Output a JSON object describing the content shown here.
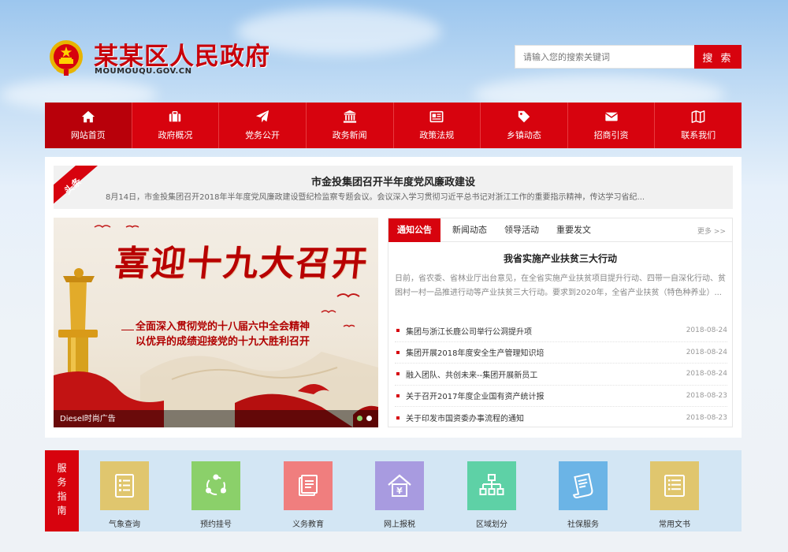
{
  "colors": {
    "brand_red": "#d7030e",
    "nav_active": "#b8000a",
    "service_bg": "#d3e6f4"
  },
  "header": {
    "emblem_icon": "national-emblem",
    "title": "某某区人民政府",
    "domain": "MOUMOUQU.GOV.CN",
    "search_placeholder": "请输入您的搜索关键词",
    "search_button": "搜 索"
  },
  "nav": {
    "items": [
      {
        "label": "网站首页",
        "icon": "home-icon",
        "active": true
      },
      {
        "label": "政府概况",
        "icon": "briefcase-icon"
      },
      {
        "label": "党务公开",
        "icon": "paper-plane-icon"
      },
      {
        "label": "政务新闻",
        "icon": "government-building-icon"
      },
      {
        "label": "政策法规",
        "icon": "newspaper-icon"
      },
      {
        "label": "乡镇动态",
        "icon": "tag-icon"
      },
      {
        "label": "招商引资",
        "icon": "envelope-icon"
      },
      {
        "label": "联系我们",
        "icon": "map-icon"
      }
    ]
  },
  "headline": {
    "tag": "头条",
    "title": "市金投集团召开半年度党风廉政建设",
    "summary": "8月14日，市金投集团召开2018年半年度党风廉政建设暨纪检监察专题会议。会议深入学习贯彻习近平总书记对浙江工作的重要指示精神，传达学习省纪..."
  },
  "banner": {
    "main_text": "喜迎十九大召开",
    "sub_line1": "全面深入贯彻党的十八届六中全会精神",
    "sub_line2": "以优异的成绩迎接党的十九大胜利召开",
    "caption": "Diesel时尚广告"
  },
  "news": {
    "tabs": [
      "通知公告",
      "新闻动态",
      "领导活动",
      "重要发文"
    ],
    "active_tab": 0,
    "more": "更多 >>",
    "feature_title": "我省实施产业扶贫三大行动",
    "feature_summary": "日前，省农委、省林业厅出台意见，在全省实施产业扶贫项目提升行动、四带一自深化行动、贫困村一村一品推进行动等产业扶贫三大行动。要求到2020年，全省产业扶贫（特色种养业）...",
    "items": [
      {
        "text": "集团与浙江长鹿公司举行公洞提升项",
        "date": "2018-08-24"
      },
      {
        "text": "集团开展2018年度安全生产管理知识培",
        "date": "2018-08-24"
      },
      {
        "text": "融入团队、共创未来--集团开展新员工",
        "date": "2018-08-24"
      },
      {
        "text": "关于召开2017年度企业国有资产统计报",
        "date": "2018-08-23"
      },
      {
        "text": "关于印发市国资委办事流程的通知",
        "date": "2018-08-23"
      }
    ]
  },
  "service": {
    "label": "服务指南",
    "items": [
      {
        "label": "气象查询",
        "icon": "document-list-icon",
        "color": "#e0c66e"
      },
      {
        "label": "预约挂号",
        "icon": "share-nodes-icon",
        "color": "#8bd06a"
      },
      {
        "label": "义务教育",
        "icon": "book-pages-icon",
        "color": "#f07e7e"
      },
      {
        "label": "网上报税",
        "icon": "tax-house-icon",
        "color": "#a89be0"
      },
      {
        "label": "区域划分",
        "icon": "org-chart-icon",
        "color": "#5ed1a6"
      },
      {
        "label": "社保服务",
        "icon": "scroll-doc-icon",
        "color": "#6bb4e6"
      },
      {
        "label": "常用文书",
        "icon": "form-doc-icon",
        "color": "#e0c66e"
      }
    ]
  }
}
